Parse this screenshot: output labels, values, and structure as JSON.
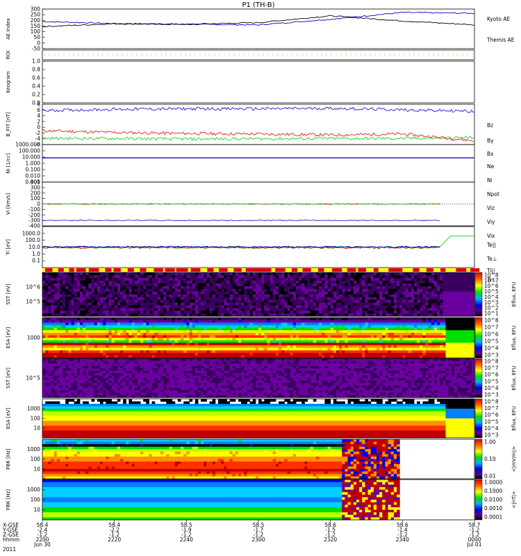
{
  "title": "P1 (TH-B)",
  "colors": {
    "red": "#e00000",
    "green": "#00cc00",
    "blue": "#0000c8",
    "yellow": "#ffff00"
  },
  "footer": {
    "row_labels": [
      "X-GSE",
      "Y-GSE",
      "Z-GSE",
      "hhmm",
      "2011"
    ],
    "ticks": [
      {
        "x": "58.4",
        "y": "-2.4",
        "z": "-1.2",
        "time": "2200",
        "date": "Jun 30"
      },
      {
        "x": "58.4",
        "y": "-2.2",
        "z": "-1.2",
        "time": "2220",
        "date": ""
      },
      {
        "x": "58.5",
        "y": "-1.9",
        "z": "-1.2",
        "time": "2240",
        "date": ""
      },
      {
        "x": "58.5",
        "y": "-1.7",
        "z": "-1.2",
        "time": "2300",
        "date": ""
      },
      {
        "x": "58.6",
        "y": "-1.5",
        "z": "-1.2",
        "time": "2320",
        "date": ""
      },
      {
        "x": "58.6",
        "y": "-1.4",
        "z": "-1.2",
        "time": "2340",
        "date": ""
      },
      {
        "x": "58.7",
        "y": "-1.2",
        "z": "-1.2",
        "time": "0000",
        "date": "Jul 01"
      }
    ]
  },
  "chart_data": [
    {
      "type": "line",
      "ylabel": "AE Index",
      "ylim": [
        -50,
        300
      ],
      "yticks": [
        "300",
        "250",
        "200",
        "150",
        "100",
        "50",
        "0",
        "-50"
      ],
      "x": [
        "2200",
        "2220",
        "2240",
        "2300",
        "2320",
        "2340",
        "0000"
      ],
      "series": [
        {
          "name": "Kyoto AE",
          "color": "#0000c8",
          "values": [
            190,
            172,
            165,
            160,
            210,
            270,
            262
          ]
        },
        {
          "name": "Themis AE",
          "color": "#000000",
          "values": [
            145,
            170,
            165,
            180,
            240,
            195,
            160
          ]
        }
      ]
    },
    {
      "type": "line",
      "ylabel": "ROI",
      "yticks": []
    },
    {
      "type": "line",
      "ylabel": "Keogram",
      "ylim": [
        0,
        1
      ],
      "yticks": [
        "1.0",
        "0.8",
        "0.6",
        "0.4",
        "0.2",
        "0.0"
      ]
    },
    {
      "type": "line",
      "ylabel": "B_FIT [nT]",
      "ylim": [
        -8,
        8
      ],
      "yticks": [
        "8",
        "6",
        "4",
        "2",
        "0",
        "-2",
        "-4",
        "-6"
      ],
      "series": [
        {
          "name": "Bz",
          "color": "#e00000",
          "values": [
            -2.5,
            -3.2,
            -3.6,
            -3.8,
            -4.2,
            -3.8,
            -6.5
          ]
        },
        {
          "name": "By",
          "color": "#00cc00",
          "values": [
            -5.5,
            -5.6,
            -5.8,
            -5.7,
            -5.6,
            -5.6,
            -5.2
          ]
        },
        {
          "name": "Bx",
          "color": "#0000c8",
          "values": [
            5.5,
            6.0,
            6.2,
            6.2,
            6.4,
            5.8,
            5.2
          ]
        }
      ]
    },
    {
      "type": "line",
      "ylabel": "Ni [1/cc]",
      "ylim_log": [
        0.001,
        1000
      ],
      "yticks": [
        "1000.000",
        "100.000",
        "10.000",
        "1.000",
        "0.100",
        "0.010",
        "0.001"
      ],
      "series": [
        {
          "name": "Ne",
          "color": "#e00000",
          "values": [
            7.5,
            7.5,
            7.5,
            7.5,
            7.5,
            7.5,
            7.5
          ]
        },
        {
          "name": "Ni",
          "color": "#000000",
          "values": [
            7.8,
            7.8,
            7.8,
            7.8,
            7.8,
            7.8,
            7.8
          ]
        },
        {
          "name": "Npot",
          "color": "#0000c8",
          "values": [
            7.2,
            7.2,
            7.2,
            7.2,
            7.2,
            7.2,
            7.2
          ]
        }
      ]
    },
    {
      "type": "line",
      "ylabel": "Vi [km/s]",
      "ylim": [
        -400,
        400
      ],
      "yticks": [
        "400",
        "300",
        "200",
        "100",
        "0",
        "-100",
        "-200",
        "-300",
        "-400"
      ],
      "series": [
        {
          "name": "Viz",
          "color": "#e00000",
          "values": [
            0,
            0,
            0,
            0,
            0,
            0
          ]
        },
        {
          "name": "Viy",
          "color": "#00cc00",
          "values": [
            0,
            0,
            0,
            0,
            0,
            0
          ]
        },
        {
          "name": "Vix",
          "color": "#0000c8",
          "values": [
            -300,
            -300,
            -300,
            -300,
            -300,
            -300
          ]
        }
      ]
    },
    {
      "type": "line",
      "ylabel": "Ti [eV]",
      "ylim_log": [
        0.01,
        10000
      ],
      "yticks": [
        "1000.0",
        "100.0",
        "10.0",
        "1.0",
        "0.1"
      ],
      "series": [
        {
          "name": "Te||",
          "color": "#000000",
          "values": [
            10,
            10,
            10,
            10,
            10,
            10
          ]
        },
        {
          "name": "Te⊥",
          "color": "#e00000",
          "values": [
            8,
            8,
            8,
            8,
            8,
            8
          ]
        },
        {
          "name": "Ti||",
          "color": "#00cc00",
          "values": [
            9,
            9,
            9,
            9,
            9,
            9
          ]
        },
        {
          "name": "Ti⊥",
          "color": "#0000c8",
          "values": [
            11,
            11,
            11,
            11,
            11,
            11
          ]
        }
      ]
    },
    {
      "type": "heatmap",
      "ylabel": "SST [eV]",
      "yticks": [
        "10^6",
        "10^5"
      ],
      "colorbar_label": "Eflux, EFU",
      "colorbar_ticks": [
        "10^8",
        "10^7",
        "10^6",
        "10^5",
        "10^4",
        "10^3",
        "10^2",
        "10^1"
      ]
    },
    {
      "type": "heatmap",
      "ylabel": "ESA [eV]",
      "yticks": [
        "1000"
      ],
      "colorbar_label": "Eflux, EFU",
      "colorbar_ticks": [
        "10^8",
        "10^7",
        "10^6",
        "10^5",
        "10^4",
        "10^3"
      ]
    },
    {
      "type": "heatmap",
      "ylabel": "SST [eV]",
      "yticks": [
        "10^5"
      ],
      "colorbar_label": "Eflux, EFU",
      "colorbar_ticks": [
        "10^8",
        "10^7",
        "10^6",
        "10^5",
        "10^4",
        "10^3"
      ]
    },
    {
      "type": "heatmap",
      "ylabel": "ESA [eV]",
      "yticks": [
        "1000",
        "100",
        "10"
      ],
      "colorbar_label": "Eflux, EFU",
      "colorbar_ticks": [
        "10^8",
        "10^7",
        "10^6",
        "10^5",
        "10^4",
        "10^3"
      ]
    },
    {
      "type": "heatmap",
      "ylabel": "FBK [Hz]",
      "yticks": [
        "1000",
        "100",
        "10"
      ],
      "colorbar_label": "<|mV/m|>",
      "colorbar_ticks": [
        "1.00",
        "0.10",
        "0.01"
      ]
    },
    {
      "type": "heatmap",
      "ylabel": "FBK [Hz]",
      "yticks": [
        "1000",
        "100",
        "10"
      ],
      "colorbar_label": "<|nT|>",
      "colorbar_ticks": [
        "1.0000",
        "0.1000",
        "0.0100",
        "0.0010",
        "0.0001"
      ]
    }
  ]
}
